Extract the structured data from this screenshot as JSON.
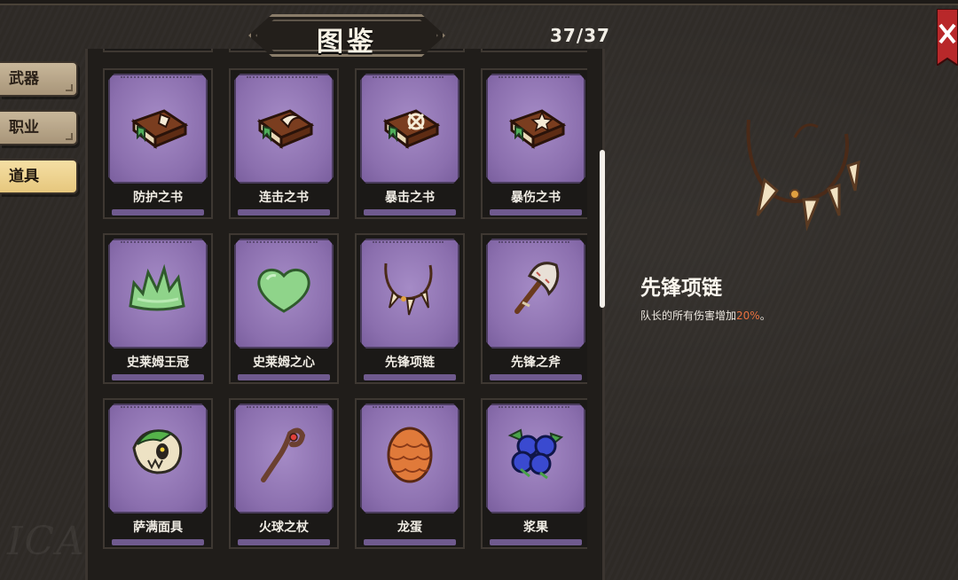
{
  "header": {
    "title": "图鉴",
    "counter": "37/37"
  },
  "tabs": [
    {
      "label": "武器",
      "active": false
    },
    {
      "label": "职业",
      "active": false
    },
    {
      "label": "道具",
      "active": true
    }
  ],
  "items": [
    {
      "name": "防护之书",
      "icon": "book-shield-icon"
    },
    {
      "name": "连击之书",
      "icon": "book-slash-icon"
    },
    {
      "name": "暴击之书",
      "icon": "book-crosshair-icon"
    },
    {
      "name": "暴伤之书",
      "icon": "book-star-icon"
    },
    {
      "name": "史莱姆王冠",
      "icon": "slime-crown-icon"
    },
    {
      "name": "史莱姆之心",
      "icon": "slime-heart-icon"
    },
    {
      "name": "先锋项链",
      "icon": "fang-necklace-icon"
    },
    {
      "name": "先锋之斧",
      "icon": "axe-icon"
    },
    {
      "name": "萨满面具",
      "icon": "shaman-mask-icon"
    },
    {
      "name": "火球之杖",
      "icon": "fireball-staff-icon"
    },
    {
      "name": "龙蛋",
      "icon": "dragon-egg-icon"
    },
    {
      "name": "浆果",
      "icon": "berries-icon"
    }
  ],
  "detail": {
    "name": "先锋项链",
    "desc_prefix": "队长的所有伤害增加",
    "desc_value": "20%",
    "desc_suffix": "。",
    "icon": "fang-necklace-icon"
  },
  "colors": {
    "card_purple": "#8b6fae",
    "tab_active": "#e6c77d",
    "highlight": "#e8713f",
    "close_red": "#b8282a"
  }
}
